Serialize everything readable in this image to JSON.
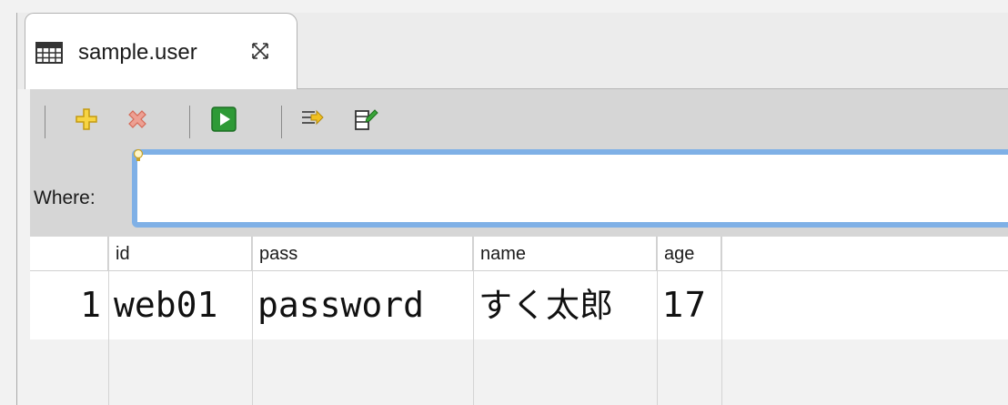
{
  "tab": {
    "title": "sample.user",
    "icon": "table-icon",
    "close_icon": "close-icon"
  },
  "toolbar": {
    "tools": [
      {
        "name": "add-row-icon",
        "color": "#f0c020"
      },
      {
        "name": "delete-row-icon",
        "color": "#e07a6a"
      },
      {
        "name": "run-icon",
        "color": "#2e9a36"
      },
      {
        "name": "wrap-icon",
        "color": "#444444"
      },
      {
        "name": "edit-columns-icon",
        "color": "#444444"
      }
    ]
  },
  "where": {
    "label": "Where:",
    "value": ""
  },
  "table": {
    "columns": [
      "id",
      "pass",
      "name",
      "age"
    ],
    "rows": [
      {
        "num": "1",
        "cells": [
          "web01",
          "password",
          "すく太郎",
          "17"
        ]
      }
    ]
  },
  "colors": {
    "accent": "#7fb0e6",
    "toolbar_bg": "#d6d6d6"
  }
}
